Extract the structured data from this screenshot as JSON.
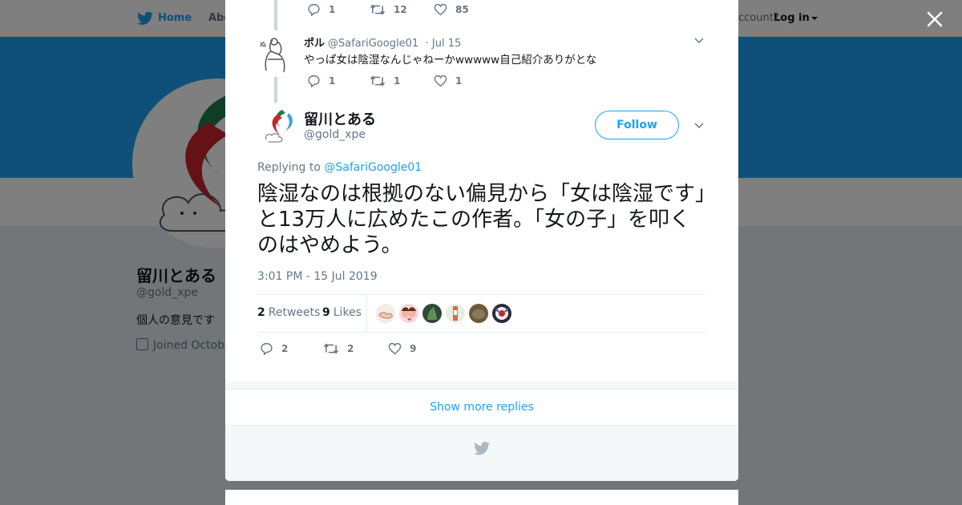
{
  "background": {
    "nav": {
      "home_label": "Home",
      "about_label": "Abo",
      "account_text": "ccount?",
      "login_label": "Log in"
    },
    "profile": {
      "name": "留川とある",
      "handle": "@gold_xpe",
      "bio": "個人の意見です",
      "joined": "Joined Octobe"
    }
  },
  "thread": {
    "parent_actions": {
      "replies": "1",
      "retweets": "12",
      "likes": "85"
    },
    "reply": {
      "name": "ポル",
      "handle": "@SafariGoogle01",
      "date": "· Jul 15",
      "text": "やっぱ女は陰湿なんじゃねーかwwwww自己紹介ありがとな",
      "replies": "1",
      "retweets": "1",
      "likes": "1"
    }
  },
  "tweet": {
    "name": "留川とある",
    "handle": "@gold_xpe",
    "follow_label": "Follow",
    "replying_prefix": "Replying to",
    "replying_to": "@SafariGoogle01",
    "text": "陰湿なのは根拠のない偏見から「女は陰湿です」と13万人に広めたこの作者。「女の子」を叩くのはやめよう。",
    "timestamp": "3:01 PM - 15 Jul 2019",
    "retweets_count": "2",
    "retweets_label": "Retweets",
    "likes_count": "9",
    "likes_label": "Likes",
    "actions": {
      "replies": "2",
      "retweets": "2",
      "likes": "9"
    }
  },
  "show_more_label": "Show more replies",
  "colors": {
    "accent": "#1da1f2",
    "muted": "#657786",
    "text": "#14171a",
    "banner": "#1da1f2"
  },
  "icons": [
    "twitter-bird-icon",
    "close-icon",
    "reply-icon",
    "retweet-icon",
    "heart-icon",
    "chevron-down-icon",
    "calendar-icon"
  ]
}
